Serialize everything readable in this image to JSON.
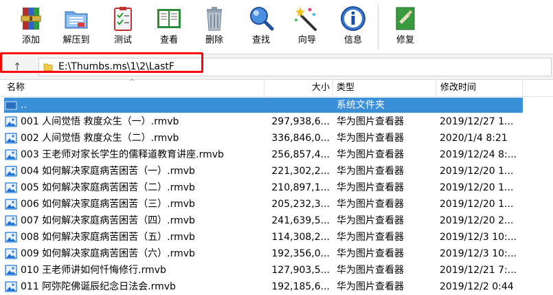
{
  "toolbar": {
    "buttons": [
      {
        "id": "add",
        "label": "添加",
        "icon": "archive-add-icon"
      },
      {
        "id": "extract",
        "label": "解压到",
        "icon": "folder-extract-icon"
      },
      {
        "id": "test",
        "label": "测试",
        "icon": "clipboard-check-icon"
      },
      {
        "id": "view",
        "label": "查看",
        "icon": "book-view-icon"
      },
      {
        "id": "delete",
        "label": "删除",
        "icon": "trash-icon"
      },
      {
        "id": "find",
        "label": "查找",
        "icon": "magnifier-icon"
      },
      {
        "id": "wizard",
        "label": "向导",
        "icon": "magic-wand-icon"
      },
      {
        "id": "info",
        "label": "信息",
        "icon": "info-icon"
      },
      {
        "id": "repair",
        "label": "修复",
        "icon": "repair-icon"
      }
    ]
  },
  "addressbar": {
    "up_glyph": "↑",
    "path": "E:\\Thumbs.ms\\1\\2\\LastF"
  },
  "columns": {
    "name": "名称",
    "size": "大小",
    "type": "类型",
    "modified": "修改时间"
  },
  "rows": [
    {
      "name": "..",
      "size": "",
      "type": "系统文件夹",
      "modified": "",
      "selected": true,
      "icon": "folder-icon"
    },
    {
      "name": "001 人间觉悟 救度众生（一）.rmvb",
      "size": "297,938,6...",
      "type": "华为图片查看器",
      "modified": "2019/12/27 1..."
    },
    {
      "name": "002 人间觉悟 救度众生（二）.rmvb",
      "size": "336,846,0...",
      "type": "华为图片查看器",
      "modified": "2020/1/4 8:21"
    },
    {
      "name": "003 王老师对家长学生的儒释道教育讲座.rmvb",
      "size": "256,857,4...",
      "type": "华为图片查看器",
      "modified": "2019/12/24 8:..."
    },
    {
      "name": "004 如何解决家庭病苦困苦（一）.rmvb",
      "size": "221,302,2...",
      "type": "华为图片查看器",
      "modified": "2019/12/20 1..."
    },
    {
      "name": "005 如何解决家庭病苦困苦（二）.rmvb",
      "size": "210,897,1...",
      "type": "华为图片查看器",
      "modified": "2019/12/20 1..."
    },
    {
      "name": "006 如何解决家庭病苦困苦（三）.rmvb",
      "size": "205,232,3...",
      "type": "华为图片查看器",
      "modified": "2019/12/20 1..."
    },
    {
      "name": "007 如何解决家庭病苦困苦（四）.rmvb",
      "size": "241,639,5...",
      "type": "华为图片查看器",
      "modified": "2019/12/20 2..."
    },
    {
      "name": "008 如何解决家庭病苦困苦（五）.rmvb",
      "size": "114,308,2...",
      "type": "华为图片查看器",
      "modified": "2019/12/3 10:..."
    },
    {
      "name": "009 如何解决家庭病苦困苦（六）.rmvb",
      "size": "192,356,0...",
      "type": "华为图片查看器",
      "modified": "2019/12/3 10:..."
    },
    {
      "name": "010 王老师讲如何忏悔修行.rmvb",
      "size": "127,903,5...",
      "type": "华为图片查看器",
      "modified": "2019/12/21 7:..."
    },
    {
      "name": "011 阿弥陀佛诞辰纪念日法会.rmvb",
      "size": "192,185,6...",
      "type": "华为图片查看器",
      "modified": "2019/12/2 0:44"
    }
  ],
  "colors": {
    "selection": "#3a8fd9",
    "highlight": "#ff0000"
  }
}
